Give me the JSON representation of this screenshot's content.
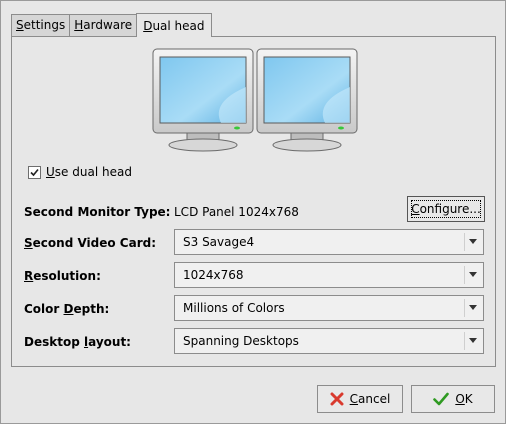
{
  "tabs": [
    {
      "label": "Settings",
      "mnemonic": "S",
      "rest": "ettings"
    },
    {
      "label": "Hardware",
      "mnemonic": "H",
      "rest": "ardware"
    },
    {
      "label": "Dual head",
      "mnemonic": "D",
      "rest": "ual head"
    }
  ],
  "active_tab": "Dual head",
  "dual_head": {
    "checkbox": {
      "mnemonic": "U",
      "rest": "se dual head",
      "checked": true
    },
    "second_monitor": {
      "label": "Second Monitor Type:",
      "value": "LCD Panel 1024x768",
      "configure_mnemonic": "C",
      "configure_rest": "onfigure..."
    },
    "second_video_card": {
      "label_mnemonic": "S",
      "label_rest": "econd Video Card:",
      "value": "S3 Savage4"
    },
    "resolution": {
      "label_mnemonic": "R",
      "label_rest": "esolution:",
      "value": "1024x768"
    },
    "color_depth": {
      "label_prefix": "Color ",
      "label_mnemonic": "D",
      "label_rest": "epth:",
      "value": "Millions of Colors"
    },
    "desktop_layout": {
      "label_prefix": "Desktop ",
      "label_mnemonic": "l",
      "label_rest": "ayout:",
      "value": "Spanning Desktops"
    }
  },
  "buttons": {
    "cancel": {
      "mnemonic": "C",
      "rest": "ancel",
      "icon": "cancel-x-icon"
    },
    "ok": {
      "mnemonic": "O",
      "rest": "K",
      "icon": "ok-check-icon"
    }
  },
  "colors": {
    "screen": "#8ecfee",
    "bezel": "#e4e4e4",
    "power_led": "#37c83a",
    "cancel_icon": "#d93a2e",
    "ok_icon": "#2f9a22"
  }
}
